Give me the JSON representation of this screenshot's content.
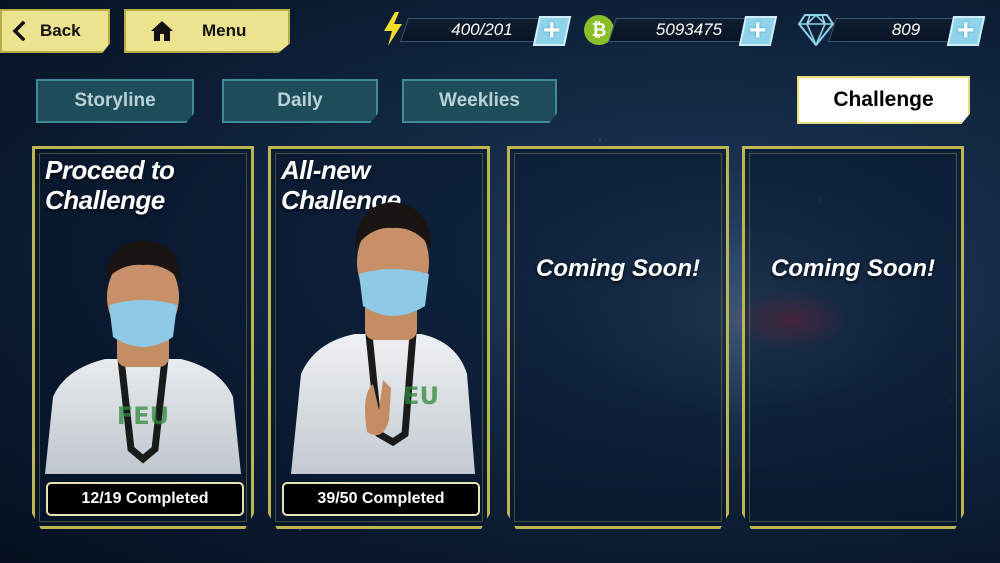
{
  "nav": {
    "back_label": "Back",
    "menu_label": "Menu"
  },
  "currencies": {
    "energy": {
      "value": "400/201",
      "icon": "lightning-icon",
      "color": "#f2dd2c"
    },
    "coins": {
      "value": "5093475",
      "icon": "bitcoin-icon",
      "color": "#8bbf2a"
    },
    "gems": {
      "value": "809",
      "icon": "diamond-icon",
      "color": "#8fd3ea"
    }
  },
  "tabs": [
    {
      "label": "Storyline",
      "active": false
    },
    {
      "label": "Daily",
      "active": false
    },
    {
      "label": "Weeklies",
      "active": false
    },
    {
      "label": "Challenge",
      "active": true
    }
  ],
  "cards": [
    {
      "title": "Proceed to Challenge",
      "progress": "12/19 Completed",
      "completed": 12,
      "total": 19
    },
    {
      "title": "All-new Challenge",
      "progress": "39/50 Completed",
      "completed": 39,
      "total": 50
    },
    {
      "title": "Coming Soon!"
    },
    {
      "title": "Coming Soon!"
    }
  ],
  "colors": {
    "accent_yellow": "#ece38f",
    "card_border": "#bdb550",
    "tab_teal": "#1f4c5a"
  }
}
